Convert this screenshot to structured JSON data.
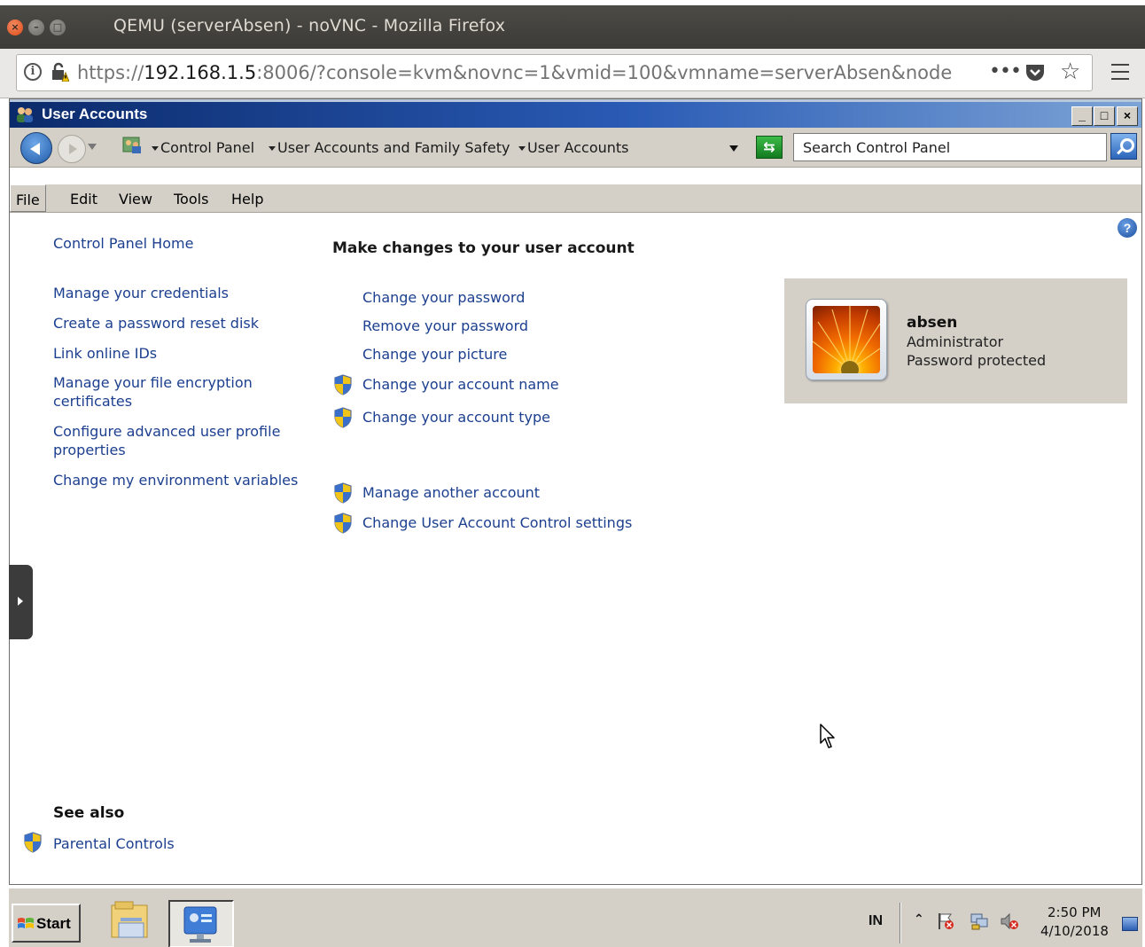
{
  "firefox": {
    "title": "QEMU (serverAbsen) - noVNC - Mozilla Firefox",
    "url_prefix": "https://",
    "url_host": "192.168.1.5",
    "url_rest": ":8006/?console=kvm&novnc=1&vmid=100&vmname=serverAbsen&node",
    "overflow_label": "•••"
  },
  "window": {
    "title": "User Accounts",
    "controls": {
      "minimize": "_",
      "maximize": "□",
      "close": "×"
    }
  },
  "breadcrumb": {
    "items": [
      "Control Panel",
      "User Accounts and Family Safety",
      "User Accounts"
    ]
  },
  "search": {
    "placeholder": "Search Control Panel"
  },
  "menubar": {
    "items": [
      "File",
      "Edit",
      "View",
      "Tools",
      "Help"
    ]
  },
  "sidebar": {
    "home_link": "Control Panel Home",
    "links": [
      "Manage your credentials",
      "Create a password reset disk",
      "Link online IDs",
      "Manage your file encryption certificates",
      "Configure advanced user profile properties",
      "Change my environment variables"
    ],
    "see_also_heading": "See also",
    "see_also_links": [
      "Parental Controls"
    ]
  },
  "main": {
    "heading": "Make changes to your user account",
    "tasks": [
      "Change your password",
      "Remove your password",
      "Change your picture",
      "Change your account name",
      "Change your account type"
    ],
    "other_tasks": [
      "Manage another account",
      "Change User Account Control settings"
    ],
    "help_label": "?"
  },
  "user": {
    "name": "absen",
    "role": "Administrator",
    "status": "Password protected"
  },
  "taskbar": {
    "start_label": "Start",
    "language": "IN",
    "time": "2:50 PM",
    "date": "4/10/2018"
  },
  "colors": {
    "link": "#1c3f8f",
    "window_face": "#d4d0c8",
    "titlebar_start": "#0b2a6b",
    "titlebar_end": "#7da4d6"
  }
}
